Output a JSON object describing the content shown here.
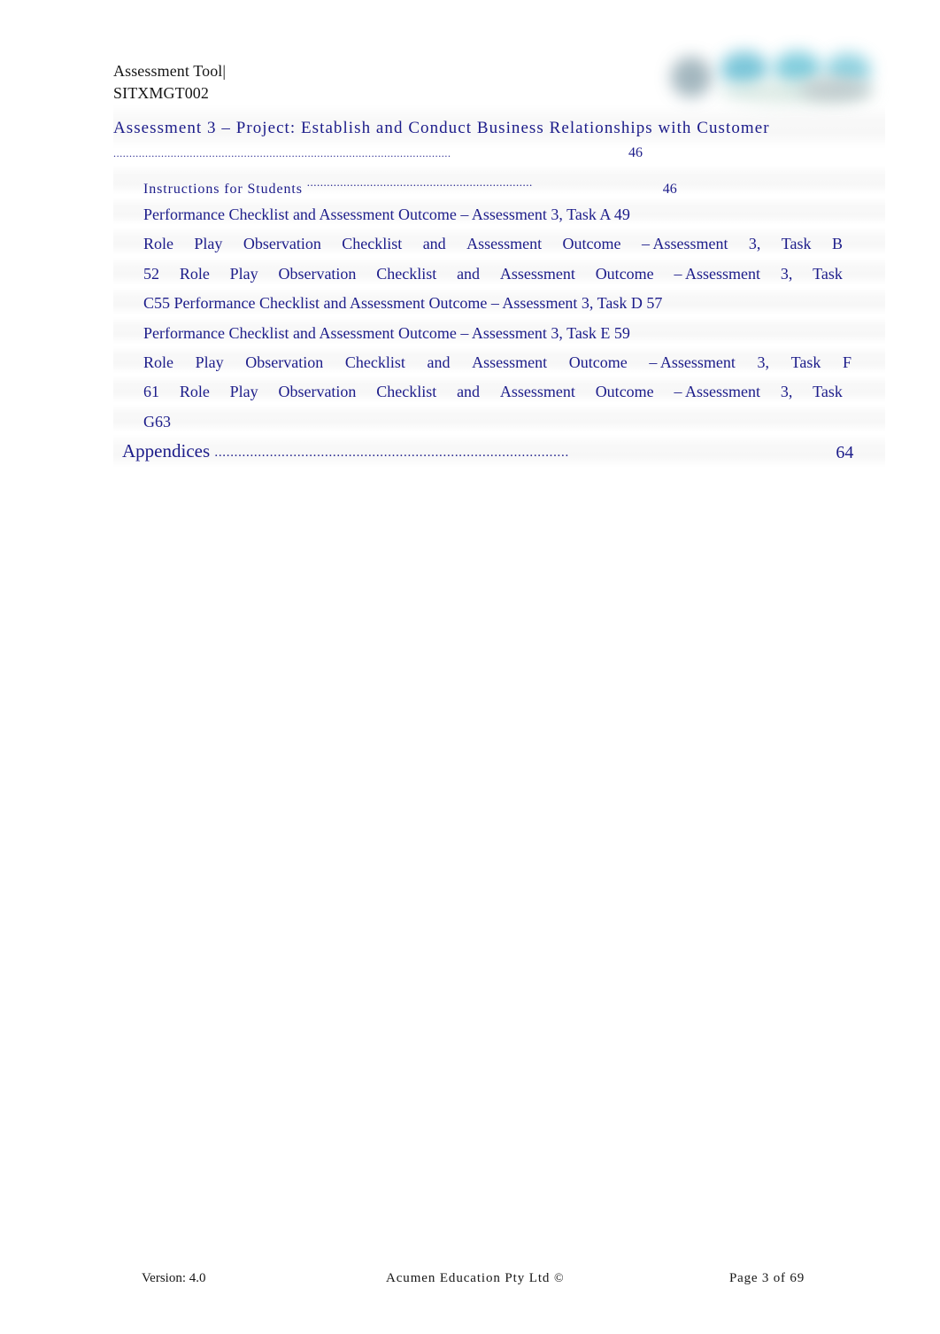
{
  "header": {
    "line1": "Assessment Tool|",
    "line2": "SITXMGT002",
    "logo_name": "acumen-education-logo"
  },
  "toc": {
    "heading1": {
      "title": "Assessment 3 – Project: Establish and Conduct Business Relationships with Customer",
      "leader": "..........................................................................................................",
      "page": "46"
    },
    "heading2": {
      "title": "Instructions for Students",
      "leader": "....................................................................",
      "page": "46"
    },
    "body_lines": [
      {
        "segments": [
          "Performance",
          "Checklist",
          "and",
          "Assessment",
          "Outcome",
          "– Assessment",
          "3,",
          "Task",
          "A",
          "49"
        ],
        "justify": false
      },
      {
        "segments": [
          "Role",
          "Play",
          "Observation",
          "Checklist",
          "and",
          "Assessment",
          "Outcome",
          "– Assessment",
          "3,",
          "Task",
          "B"
        ],
        "justify": true
      },
      {
        "segments": [
          "52",
          "Role",
          "Play",
          "Observation",
          "Checklist",
          "and",
          "Assessment",
          "Outcome",
          "– Assessment",
          "3,",
          "Task"
        ],
        "justify": true
      },
      {
        "segments": [
          "C55",
          "Performance",
          "Checklist",
          "and",
          "Assessment",
          "Outcome",
          "– Assessment",
          "3,",
          "Task",
          "D",
          "57"
        ],
        "justify": false
      },
      {
        "segments": [
          "Performance",
          "Checklist",
          "and",
          "Assessment",
          "Outcome",
          "– Assessment",
          "3,",
          "Task",
          "E",
          "59"
        ],
        "justify": false
      },
      {
        "segments": [
          "Role",
          "Play",
          "Observation",
          "Checklist",
          "and",
          "Assessment",
          "Outcome",
          "– Assessment",
          "3,",
          "Task",
          "F"
        ],
        "justify": true
      },
      {
        "segments": [
          "61",
          "Role",
          "Play",
          "Observation",
          "Checklist",
          "and",
          "Assessment",
          "Outcome",
          "– Assessment",
          "3,",
          "Task"
        ],
        "justify": true
      },
      {
        "segments": [
          "G63"
        ],
        "justify": false
      }
    ],
    "appendices": {
      "title": "Appendices",
      "leader": "..........................................................................................",
      "page": "64"
    }
  },
  "footer": {
    "version": "Version: 4.0",
    "organisation": "Acumen  Education   Pty  Ltd",
    "copyright": "©",
    "page_label": "Page 3   of  69"
  },
  "colors": {
    "toc_text": "#1c1c8a",
    "body_text": "#161616",
    "page_background": "#ffffff",
    "logo_accent": "#5fc0d4"
  }
}
